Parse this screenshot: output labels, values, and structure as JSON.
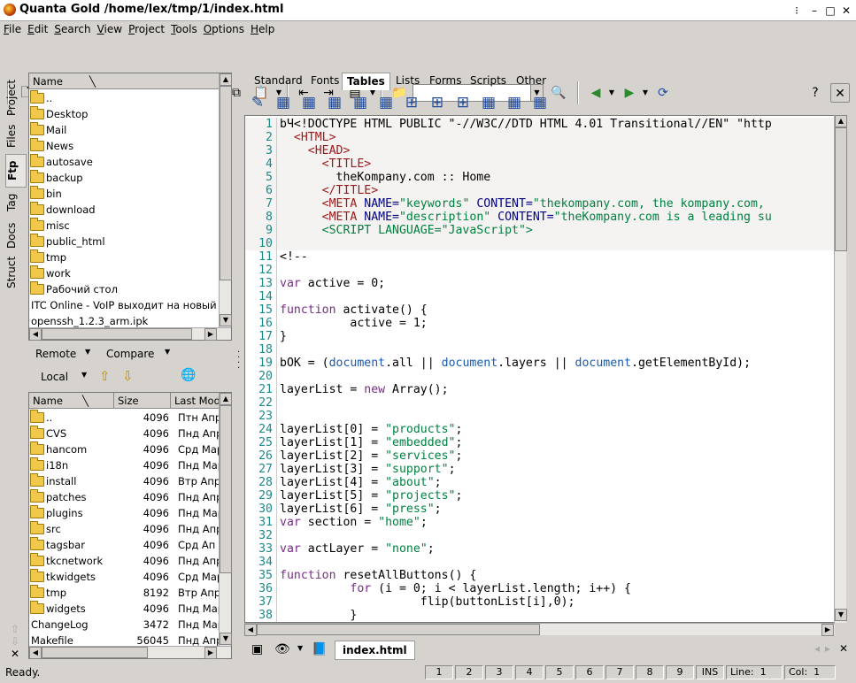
{
  "window": {
    "title": "Quanta Gold /home/lex/tmp/1/index.html"
  },
  "menu": [
    "File",
    "Edit",
    "Search",
    "View",
    "Project",
    "Tools",
    "Options",
    "Help"
  ],
  "vtabs": [
    "Project",
    "Files",
    "Ftp",
    "Tag",
    "Docs",
    "Struct"
  ],
  "htabs": [
    "Standard",
    "Fonts",
    "Tables",
    "Lists",
    "Forms",
    "Scripts",
    "Other"
  ],
  "tree_header": "Name",
  "tree": [
    {
      "name": "..",
      "folder": true
    },
    {
      "name": "Desktop",
      "folder": true
    },
    {
      "name": "Mail",
      "folder": true
    },
    {
      "name": "News",
      "folder": true
    },
    {
      "name": "autosave",
      "folder": true
    },
    {
      "name": "backup",
      "folder": true
    },
    {
      "name": "bin",
      "folder": true
    },
    {
      "name": "download",
      "folder": true
    },
    {
      "name": "misc",
      "folder": true
    },
    {
      "name": "public_html",
      "folder": true
    },
    {
      "name": "tmp",
      "folder": true
    },
    {
      "name": "work",
      "folder": true
    },
    {
      "name": "Рабочий стол",
      "folder": true
    },
    {
      "name": "ITC Online - VoIP выходит на новый",
      "folder": false
    },
    {
      "name": "openssh_1.2.3_arm.ipk",
      "folder": false
    }
  ],
  "remote_label": "Remote",
  "compare_label": "Compare",
  "local_label": "Local",
  "ftp_headers": [
    "Name",
    "Size",
    "Last Mod"
  ],
  "ftp_rows": [
    {
      "name": "..",
      "size": "4096",
      "mod": "Птн Апр",
      "folder": true
    },
    {
      "name": "CVS",
      "size": "4096",
      "mod": "Пнд Апр",
      "folder": true
    },
    {
      "name": "hancom",
      "size": "4096",
      "mod": "Срд Мар",
      "folder": true
    },
    {
      "name": "i18n",
      "size": "4096",
      "mod": "Пнд Мар",
      "folder": true
    },
    {
      "name": "install",
      "size": "4096",
      "mod": "Втр Апр",
      "folder": true
    },
    {
      "name": "patches",
      "size": "4096",
      "mod": "Пнд Апр",
      "folder": true
    },
    {
      "name": "plugins",
      "size": "4096",
      "mod": "Пнд Мар",
      "folder": true
    },
    {
      "name": "src",
      "size": "4096",
      "mod": "Пнд Апр",
      "folder": true
    },
    {
      "name": "tagsbar",
      "size": "4096",
      "mod": "Срд Ап",
      "folder": true
    },
    {
      "name": "tkcnetwork",
      "size": "4096",
      "mod": "Пнд Апр",
      "folder": true
    },
    {
      "name": "tkwidgets",
      "size": "4096",
      "mod": "Срд Мар",
      "folder": true
    },
    {
      "name": "tmp",
      "size": "8192",
      "mod": "Втр Апр",
      "folder": true
    },
    {
      "name": "widgets",
      "size": "4096",
      "mod": "Пнд Мар",
      "folder": true
    },
    {
      "name": "ChangeLog",
      "size": "3472",
      "mod": "Пнд Мар",
      "folder": false
    },
    {
      "name": "Makefile",
      "size": "56045",
      "mod": "Пнд Апр",
      "folder": false
    }
  ],
  "code_lines": [
    [
      [
        "bЧ<!DOCTYPE HTML PUBLIC \"-//W3C//DTD HTML 4.01 Transitional//EN\" \"http",
        ""
      ]
    ],
    [
      [
        "  ",
        ""
      ],
      [
        "<HTML>",
        "tagc"
      ]
    ],
    [
      [
        "    ",
        ""
      ],
      [
        "<HEAD>",
        "tagc"
      ]
    ],
    [
      [
        "      ",
        ""
      ],
      [
        "<TITLE>",
        "tagc"
      ]
    ],
    [
      [
        "        theKompany.com :: Home",
        ""
      ]
    ],
    [
      [
        "      ",
        ""
      ],
      [
        "</TITLE>",
        "tagc"
      ]
    ],
    [
      [
        "      ",
        ""
      ],
      [
        "<META ",
        "tagc"
      ],
      [
        "NAME=",
        "attr"
      ],
      [
        "\"keywords\" ",
        "str"
      ],
      [
        "CONTENT=",
        "attr"
      ],
      [
        "\"thekompany.com, the kompany.com,",
        "str"
      ]
    ],
    [
      [
        "      ",
        ""
      ],
      [
        "<META ",
        "tagc"
      ],
      [
        "NAME=",
        "attr"
      ],
      [
        "\"description\" ",
        "str"
      ],
      [
        "CONTENT=",
        "attr"
      ],
      [
        "\"theKompany.com is a leading su",
        "str"
      ]
    ],
    [
      [
        "      ",
        ""
      ],
      [
        "<SCRIPT LANGUAGE=\"JavaScript\">",
        "str"
      ]
    ],
    [
      [
        "",
        ""
      ]
    ],
    [
      [
        "<!--",
        ""
      ]
    ],
    [
      [
        "",
        ""
      ]
    ],
    [
      [
        "var",
        "kw"
      ],
      [
        " active = 0;",
        ""
      ]
    ],
    [
      [
        "",
        ""
      ]
    ],
    [
      [
        "function",
        "kw"
      ],
      [
        " activate() {",
        ""
      ]
    ],
    [
      [
        "          active = 1;",
        ""
      ]
    ],
    [
      [
        "}",
        ""
      ]
    ],
    [
      [
        "",
        ""
      ]
    ],
    [
      [
        "bOK = (",
        ""
      ],
      [
        "document",
        "bn"
      ],
      [
        ".all || ",
        ""
      ],
      [
        "document",
        "bn"
      ],
      [
        ".layers || ",
        ""
      ],
      [
        "document",
        "bn"
      ],
      [
        ".getElementById);",
        ""
      ]
    ],
    [
      [
        "",
        ""
      ]
    ],
    [
      [
        "layerList = ",
        ""
      ],
      [
        "new",
        "kw"
      ],
      [
        " Array();",
        ""
      ]
    ],
    [
      [
        "",
        ""
      ]
    ],
    [
      [
        "",
        ""
      ]
    ],
    [
      [
        "layerList[0] = ",
        ""
      ],
      [
        "\"products\"",
        "str"
      ],
      [
        ";",
        ""
      ]
    ],
    [
      [
        "layerList[1] = ",
        ""
      ],
      [
        "\"embedded\"",
        "str"
      ],
      [
        ";",
        ""
      ]
    ],
    [
      [
        "layerList[2] = ",
        ""
      ],
      [
        "\"services\"",
        "str"
      ],
      [
        ";",
        ""
      ]
    ],
    [
      [
        "layerList[3] = ",
        ""
      ],
      [
        "\"support\"",
        "str"
      ],
      [
        ";",
        ""
      ]
    ],
    [
      [
        "layerList[4] = ",
        ""
      ],
      [
        "\"about\"",
        "str"
      ],
      [
        ";",
        ""
      ]
    ],
    [
      [
        "layerList[5] = ",
        ""
      ],
      [
        "\"projects\"",
        "str"
      ],
      [
        ";",
        ""
      ]
    ],
    [
      [
        "layerList[6] = ",
        ""
      ],
      [
        "\"press\"",
        "str"
      ],
      [
        ";",
        ""
      ]
    ],
    [
      [
        "var",
        "kw"
      ],
      [
        " section = ",
        ""
      ],
      [
        "\"home\"",
        "str"
      ],
      [
        ";",
        ""
      ]
    ],
    [
      [
        "",
        ""
      ]
    ],
    [
      [
        "var",
        "kw"
      ],
      [
        " actLayer = ",
        ""
      ],
      [
        "\"none\"",
        "str"
      ],
      [
        ";",
        ""
      ]
    ],
    [
      [
        "",
        ""
      ]
    ],
    [
      [
        "function",
        "kw"
      ],
      [
        " resetAllButtons() {",
        ""
      ]
    ],
    [
      [
        "          ",
        ""
      ],
      [
        "for",
        "kw"
      ],
      [
        " (i = 0; i < layerList.length; i++) {",
        ""
      ]
    ],
    [
      [
        "                    flip(buttonList[i],0);",
        ""
      ]
    ],
    [
      [
        "          }",
        ""
      ]
    ]
  ],
  "doc_tab": "index.html",
  "status": {
    "text": "Ready.",
    "nums": [
      "1",
      "2",
      "3",
      "4",
      "5",
      "6",
      "7",
      "8",
      "9"
    ],
    "mode": "INS",
    "line": "Line:  1",
    "col": "Col:  1"
  }
}
